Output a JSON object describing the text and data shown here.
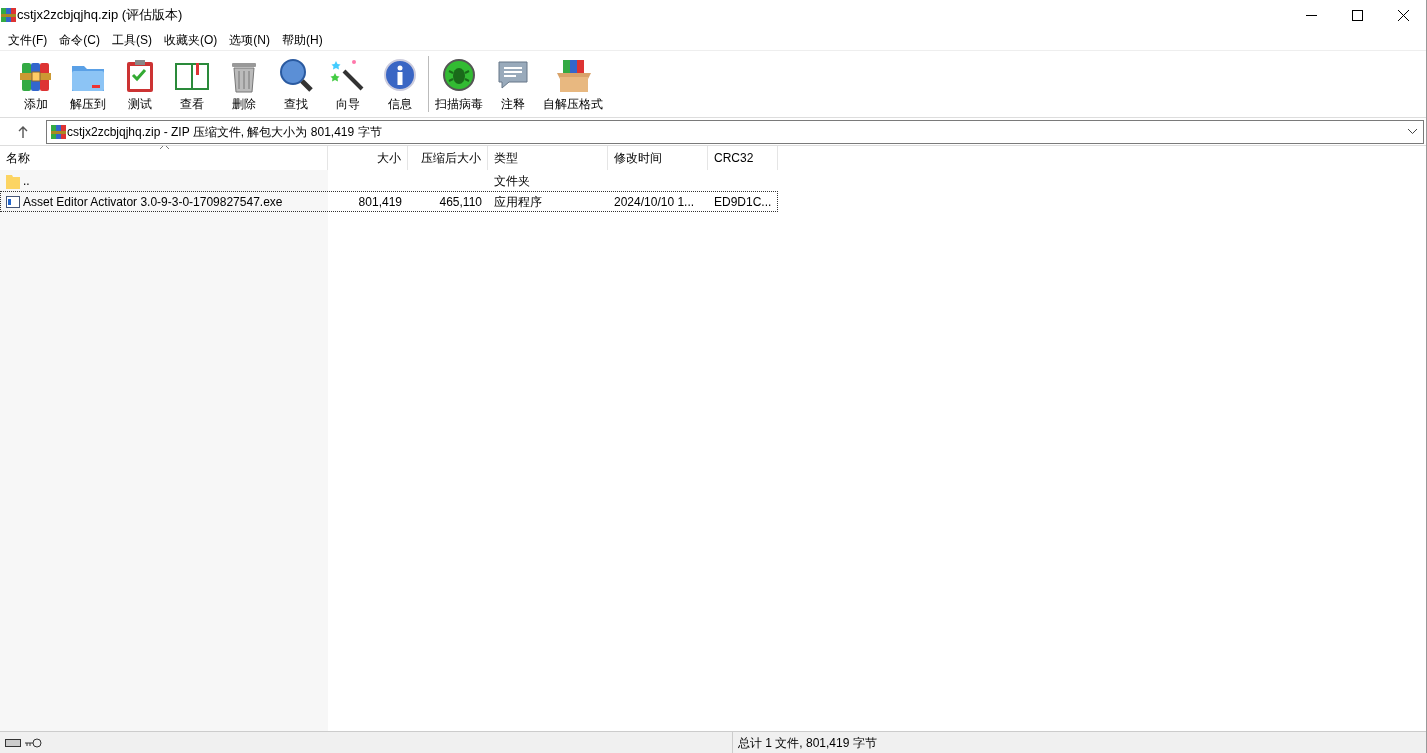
{
  "window": {
    "title": "cstjx2zcbjqjhq.zip (评估版本)"
  },
  "menu": [
    "文件(F)",
    "命令(C)",
    "工具(S)",
    "收藏夹(O)",
    "选项(N)",
    "帮助(H)"
  ],
  "toolbar": [
    {
      "label": "添加",
      "kind": "add"
    },
    {
      "label": "解压到",
      "kind": "extract"
    },
    {
      "label": "测试",
      "kind": "test"
    },
    {
      "label": "查看",
      "kind": "view"
    },
    {
      "label": "删除",
      "kind": "delete"
    },
    {
      "label": "查找",
      "kind": "find"
    },
    {
      "label": "向导",
      "kind": "wizard"
    },
    {
      "label": "信息",
      "kind": "info"
    },
    {
      "label": "扫描病毒",
      "kind": "scan"
    },
    {
      "label": "注释",
      "kind": "comment"
    },
    {
      "label": "自解压格式",
      "kind": "sfx"
    }
  ],
  "address": {
    "value": "cstjx2zcbjqjhq.zip - ZIP 压缩文件, 解包大小为 801,419 字节"
  },
  "table": {
    "columns": [
      "名称",
      "大小",
      "压缩后大小",
      "类型",
      "修改时间",
      "CRC32"
    ],
    "rows": [
      {
        "kind": "folder",
        "name": "..",
        "size": "",
        "packed": "",
        "type": "文件夹",
        "modified": "",
        "crc": "",
        "selected": false
      },
      {
        "kind": "exe",
        "name": "Asset Editor Activator 3.0-9-3-0-1709827547.exe",
        "size": "801,419",
        "packed": "465,110",
        "type": "应用程序",
        "modified": "2024/10/10 1...",
        "crc": "ED9D1C...",
        "selected": true
      }
    ]
  },
  "status_bar": {
    "text": "总计 1 文件, 801,419 字节"
  }
}
